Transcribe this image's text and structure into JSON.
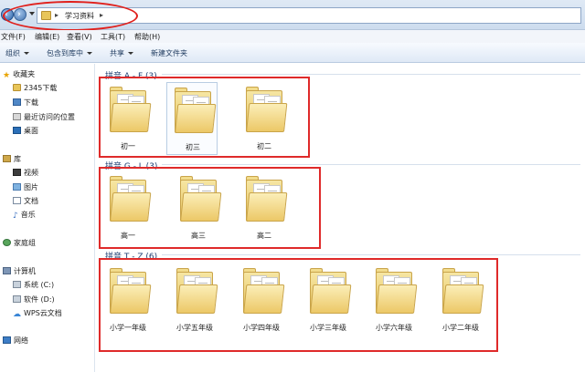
{
  "address": {
    "path": "学习资料"
  },
  "menu": {
    "items": [
      "文件(F)",
      "编辑(E)",
      "查看(V)",
      "工具(T)",
      "帮助(H)"
    ]
  },
  "toolbar": {
    "organize": "组织",
    "include": "包含到库中",
    "share": "共享",
    "new_folder": "新建文件夹"
  },
  "sidebar": {
    "favorites": "收藏夹",
    "fav_items": [
      "2345下载",
      "下载",
      "最近访问的位置",
      "桌面"
    ],
    "libraries": "库",
    "lib_items": [
      "视频",
      "图片",
      "文档",
      "音乐"
    ],
    "homegroup": "家庭组",
    "computer": "计算机",
    "pc_items": [
      "系统 (C:)",
      "软件 (D:)",
      "WPS云文档"
    ],
    "network": "网络"
  },
  "groups": [
    {
      "header": "拼音 A - F (3)",
      "items": [
        "初一",
        "初三",
        "初二"
      ]
    },
    {
      "header": "拼音 G - L (3)",
      "items": [
        "高一",
        "高三",
        "高二"
      ]
    },
    {
      "header": "拼音 T - Z (6)",
      "items": [
        "小学一年级",
        "小学五年级",
        "小学四年级",
        "小学三年级",
        "小学六年级",
        "小学二年级"
      ]
    }
  ],
  "colors": {
    "highlight": "#df2a2a",
    "group_header": "#1e3f73",
    "folder": "#e6c25c"
  }
}
